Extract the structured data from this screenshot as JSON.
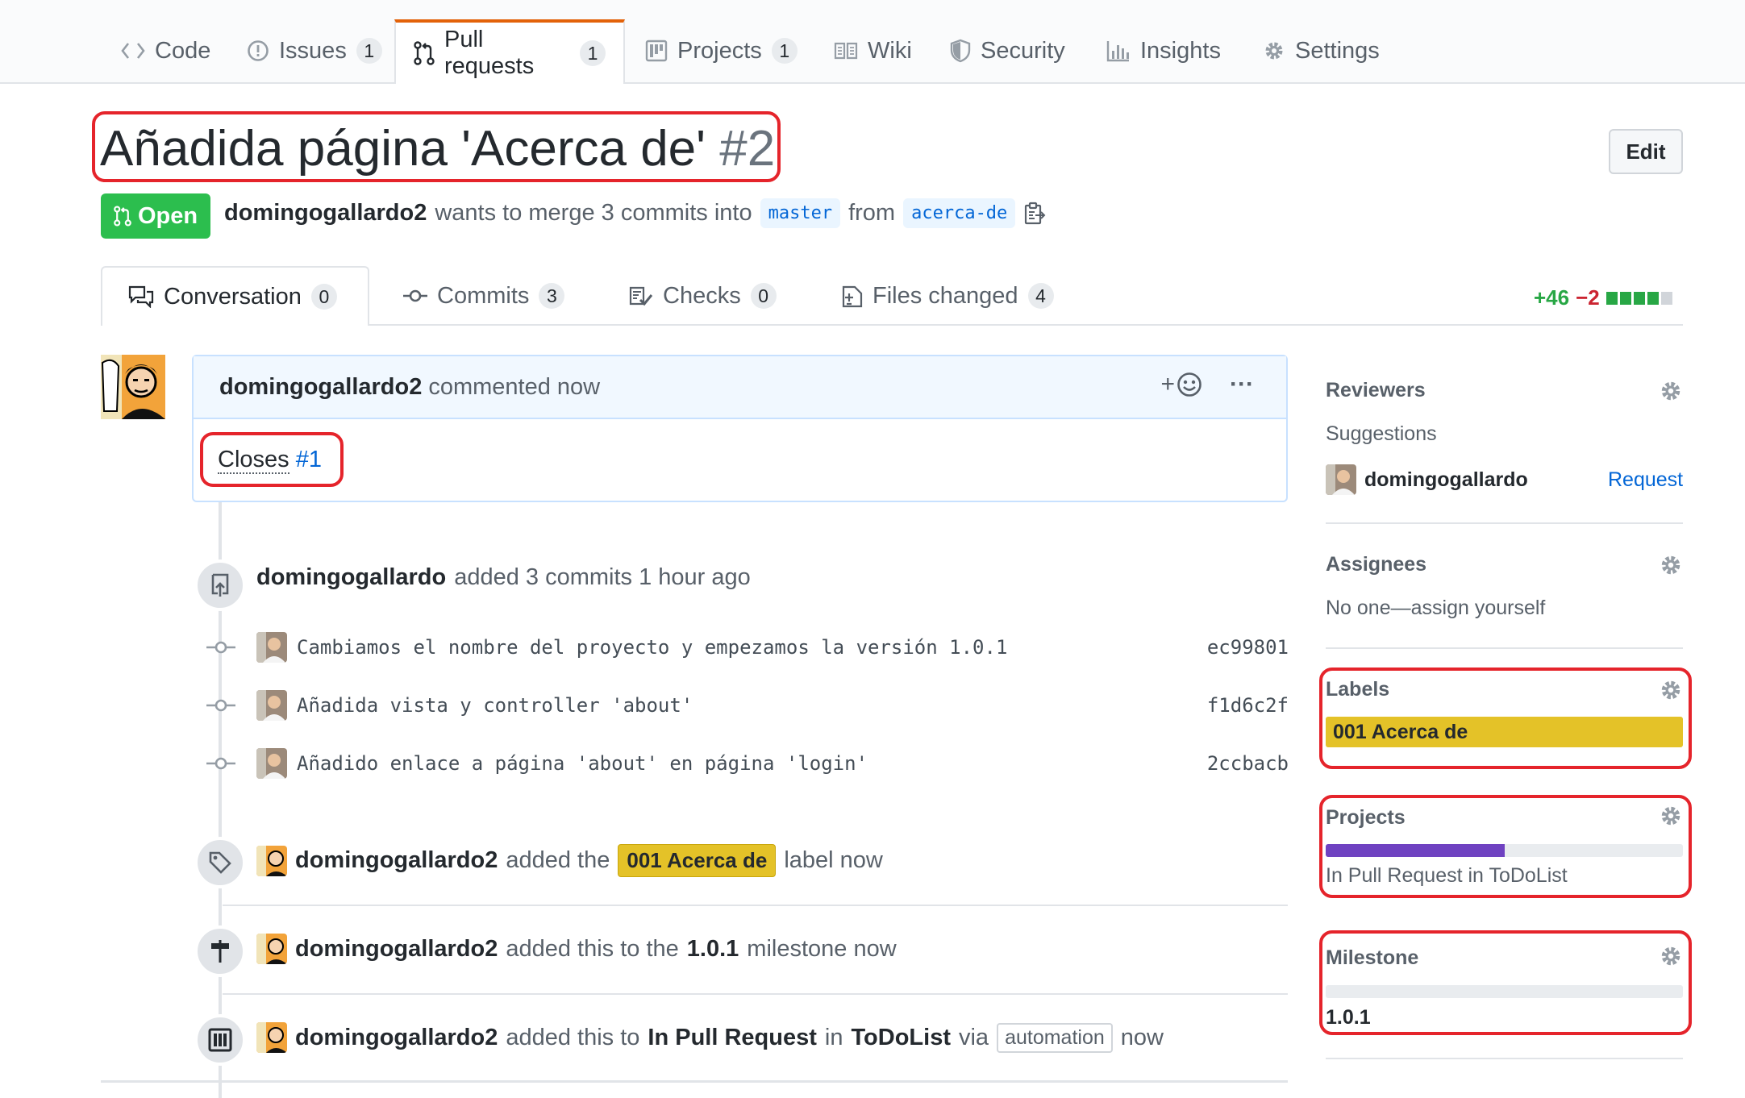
{
  "reponav": {
    "code": "Code",
    "issues": "Issues",
    "issues_count": "1",
    "pulls": "Pull requests",
    "pulls_count": "1",
    "projects": "Projects",
    "projects_count": "1",
    "wiki": "Wiki",
    "security": "Security",
    "insights": "Insights",
    "settings": "Settings"
  },
  "pr": {
    "title": "Añadida página 'Acerca de'",
    "number": "#2",
    "edit_label": "Edit",
    "state": "Open",
    "author": "domingogallardo2",
    "merge_text": "wants to merge 3 commits into",
    "base_branch": "master",
    "from_text": "from",
    "head_branch": "acerca-de"
  },
  "tabs": {
    "conversation": "Conversation",
    "conversation_count": "0",
    "commits": "Commits",
    "commits_count": "3",
    "checks": "Checks",
    "checks_count": "0",
    "files": "Files changed",
    "files_count": "4",
    "additions": "+46",
    "deletions": "−2"
  },
  "comment": {
    "author": "domingogallardo2",
    "action": "commented now",
    "reaction_plus": "+",
    "more": "···",
    "body_prefix": "Closes",
    "issue_ref": "#1"
  },
  "timeline": {
    "commits_event": {
      "author": "domingogallardo",
      "text": "added 3 commits 1 hour ago"
    },
    "commits": [
      {
        "message": "Cambiamos el nombre del proyecto y empezamos la versión 1.0.1",
        "sha": "ec99801"
      },
      {
        "message": "Añadida vista y controller 'about'",
        "sha": "f1d6c2f"
      },
      {
        "message": "Añadido enlace a página 'about' en página 'login'",
        "sha": "2ccbacb"
      }
    ],
    "label_event": {
      "author": "domingogallardo2",
      "pre": "added the",
      "label": "001 Acerca de",
      "post": "label now"
    },
    "milestone_event": {
      "author": "domingogallardo2",
      "pre": "added this to the",
      "milestone": "1.0.1",
      "post": "milestone now"
    },
    "project_event": {
      "author": "domingogallardo2",
      "pre": "added this to",
      "column": "In Pull Request",
      "in": "in",
      "project": "ToDoList",
      "via": "via",
      "chip": "automation",
      "post": "now"
    }
  },
  "sidebar": {
    "reviewers": {
      "heading": "Reviewers",
      "suggestions": "Suggestions",
      "user": "domingogallardo",
      "request": "Request"
    },
    "assignees": {
      "heading": "Assignees",
      "text": "No one—assign yourself"
    },
    "labels": {
      "heading": "Labels",
      "label": "001 Acerca de"
    },
    "projects": {
      "heading": "Projects",
      "status": "In Pull Request in ToDoList",
      "progress": 0.5
    },
    "milestone": {
      "heading": "Milestone",
      "name": "1.0.1",
      "progress": 0.0
    }
  },
  "colors": {
    "open_green": "#2cbe4e",
    "label_yellow": "#e4c228",
    "project_purple": "#6f42c1",
    "highlight_red": "#e5242b",
    "tab_accent": "#e36209"
  }
}
